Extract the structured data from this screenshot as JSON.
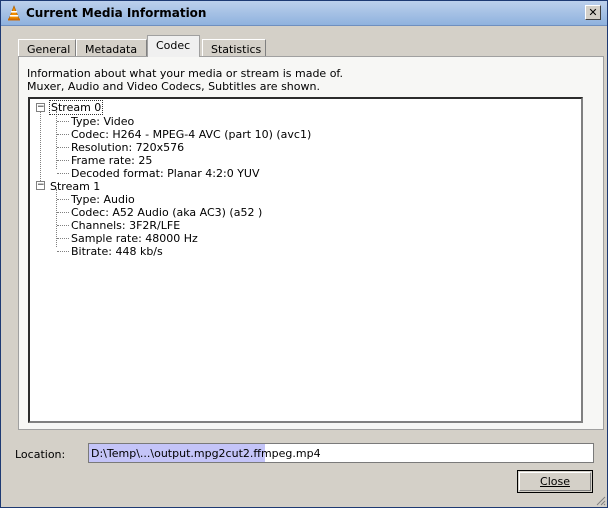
{
  "window": {
    "title": "Current Media Information",
    "close_glyph": "✕"
  },
  "tabs": [
    {
      "label": "General",
      "active": false
    },
    {
      "label": "Metadata",
      "active": false
    },
    {
      "label": "Codec",
      "active": true
    },
    {
      "label": "Statistics",
      "active": false
    }
  ],
  "codec": {
    "description_line1": "Information about what your media or stream is made of.",
    "description_line2": "Muxer, Audio and Video Codecs, Subtitles are shown.",
    "streams": [
      {
        "label": "Stream 0",
        "expander": "−",
        "items": [
          "Type: Video",
          "Codec: H264 - MPEG-4 AVC (part 10) (avc1)",
          "Resolution: 720x576",
          "Frame rate: 25",
          "Decoded format: Planar 4:2:0 YUV"
        ]
      },
      {
        "label": "Stream 1",
        "expander": "−",
        "items": [
          "Type: Audio",
          "Codec: A52 Audio (aka AC3) (a52 )",
          "Channels: 3F2R/LFE",
          "Sample rate: 48000 Hz",
          "Bitrate: 448 kb/s"
        ]
      }
    ]
  },
  "location": {
    "label": "Location:",
    "value": "D:\\Temp\\...\\output.mpg2cut2.ffmpeg.mp4"
  },
  "buttons": {
    "close_label": "Close"
  },
  "colors": {
    "titlebar_top": "#bcd0ec",
    "titlebar_bottom": "#8fb2de",
    "selection": "#c4c4f8"
  }
}
